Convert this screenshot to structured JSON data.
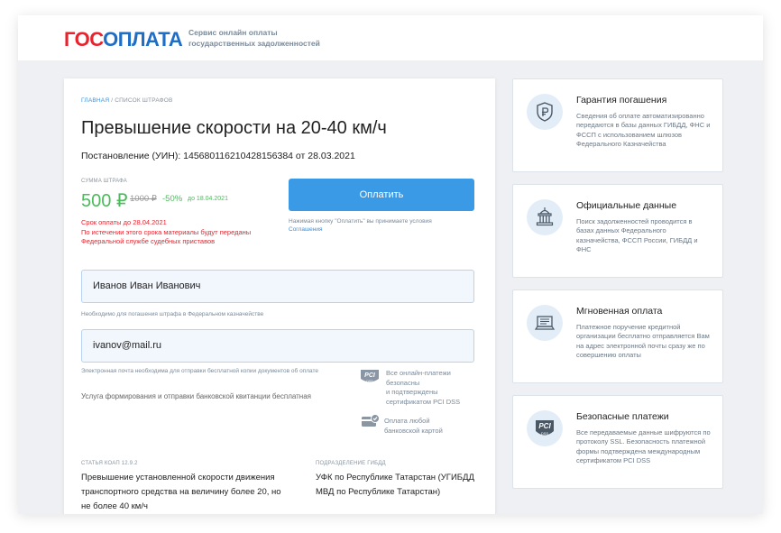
{
  "header": {
    "logo_part1": "ГОС",
    "logo_part2": "ОПЛАТА",
    "tagline_line1": "Сервис онлайн оплаты",
    "tagline_line2": "государственных задолженностей"
  },
  "breadcrumb": {
    "home": "ГЛАВНАЯ",
    "separator": " / ",
    "current": "СПИСОК ШТРАФОВ"
  },
  "fine": {
    "title": "Превышение скорости на 20-40 км/ч",
    "resolution": "Постановление (УИН): 14568011621042815638​4 от 28.03.2021",
    "sum_label": "СУММА ШТРАФА",
    "price": "500 ₽",
    "old_price": "1000 ₽",
    "discount": "-50%",
    "discount_until": "до 18.04.2021",
    "deadline_line1": "Срок оплаты до 28.04.2021",
    "deadline_line2": "По истечении этого срока материалы будут переданы",
    "deadline_line3": "Федеральной службе судебных приставов"
  },
  "pay": {
    "button_label": "Оплатить",
    "note": "Нажимая кнопку \"Оплатить\" вы принимаете условия",
    "note_link": "Соглашения"
  },
  "form": {
    "name_value": "Иванов Иван Иванович",
    "name_hint": "Необходимо для погашения штрафа в Федеральном казначействе",
    "email_value": "ivanov@mail.ru",
    "email_hint": "Электронная почта необходима для отправки бесплатной копии документов об оплате",
    "service_note": "Услуга формирования и отправки банковской квитанции бесплатная"
  },
  "security": {
    "pci_line1": "Все онлайн-платежи",
    "pci_line2": "безопасны",
    "pci_line3": "и подтверждены",
    "pci_line4": "сертификатом PCI DSS",
    "card_line1": "Оплата любой",
    "card_line2": "банковской картой"
  },
  "details": {
    "article_label": "СТАТЬЯ КОАП 12.9.2",
    "article_text": "Превышение установленной скорости движения транспортного средства на величину более 20, но не более 40 км/ч",
    "department_label": "ПОДРАЗДЕЛЕНИЕ ГИБДД",
    "department_text": "УФК по Республике Татарстан (УГИБДД МВД по Республике Татарстан)"
  },
  "features": [
    {
      "icon": "ruble-shield-icon",
      "title": "Гарантия погашения",
      "desc": "Сведения об оплате автоматизированно передаются в базы данных ГИБДД, ФНС и ФССП с использованием шлюзов Федерального Казначейства"
    },
    {
      "icon": "government-building-icon",
      "title": "Официальные данные",
      "desc": "Поиск задолженностей проводится в базах данных Федерального казначейства, ФССП России, ГИБДД и ФНС"
    },
    {
      "icon": "laptop-document-icon",
      "title": "Мгновенная оплата",
      "desc": "Платежное поручение кредитной организации бесплатно отправляется Вам на адрес электронной почты сразу же по совершению оплаты"
    },
    {
      "icon": "pci-dss-icon",
      "title": "Безопасные платежи",
      "desc": "Все передаваемые данные шифруются по протоколу SSL. Безопасность платежной формы подтверждена международным сертификатом PCI DSS"
    }
  ],
  "colors": {
    "accent_blue": "#3b9ae6",
    "logo_red": "#e8232d",
    "logo_blue": "#1f6ec6",
    "price_green": "#4cbb5c",
    "warning_red": "#e8232d"
  }
}
